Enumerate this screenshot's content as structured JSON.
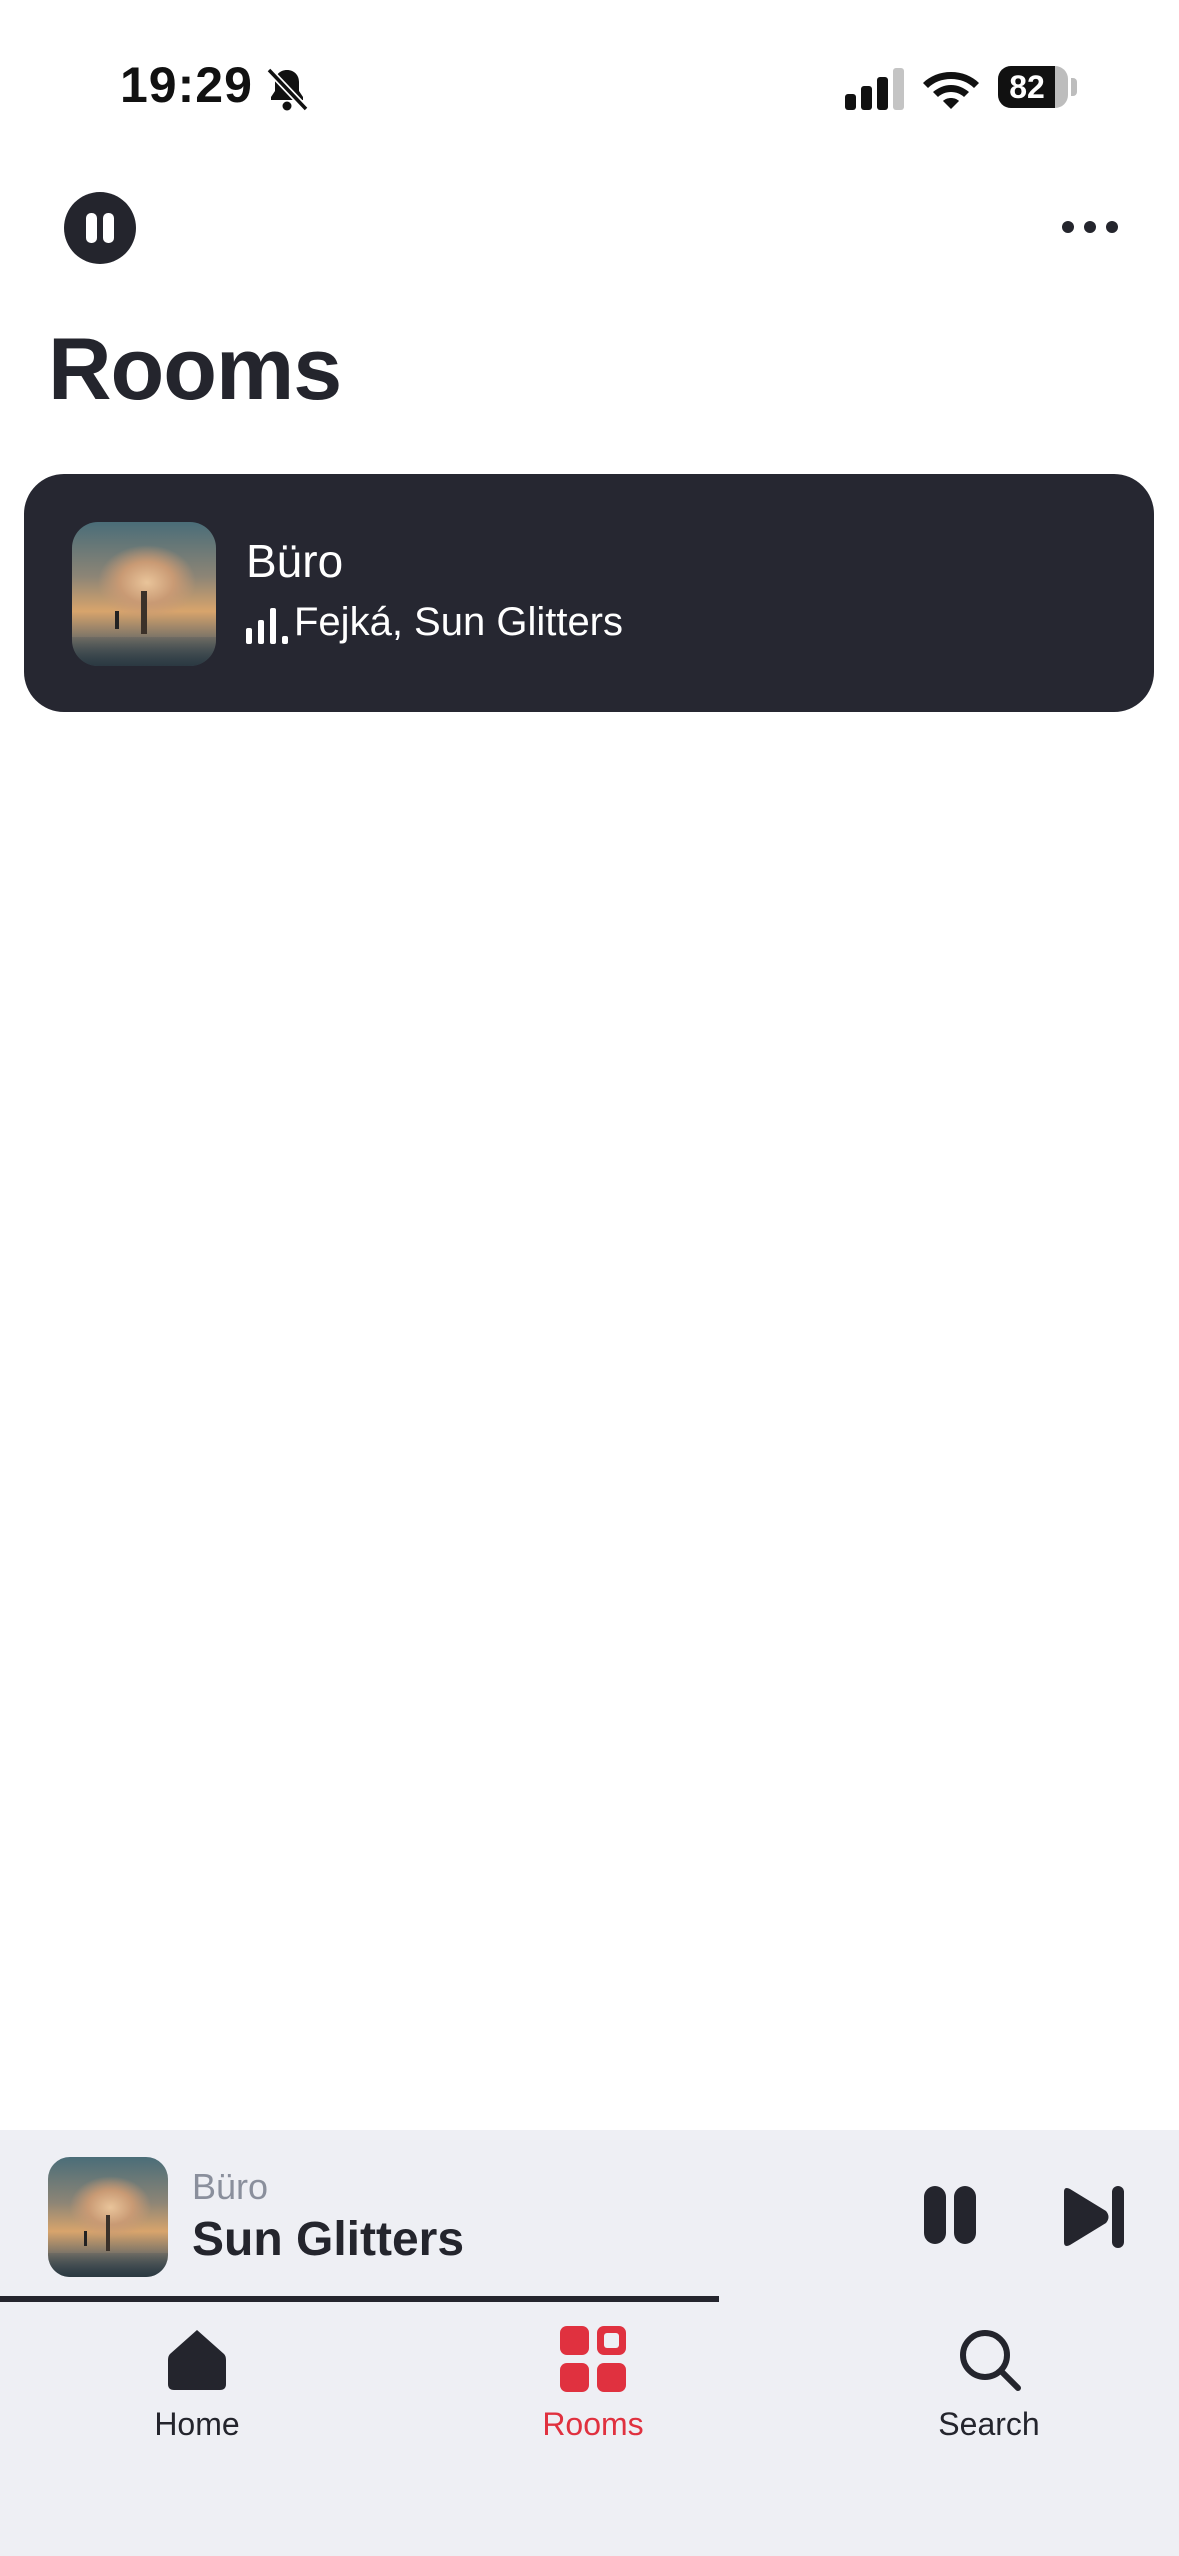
{
  "status_bar": {
    "time": "19:29",
    "battery": "82",
    "icons": [
      "bell-slash-icon",
      "cellular-signal-icon",
      "wifi-icon",
      "battery-icon"
    ]
  },
  "header": {
    "play_state_icon": "pause-icon",
    "more_icon": "ellipsis-icon",
    "title": "Rooms"
  },
  "rooms": [
    {
      "name": "Büro",
      "now_playing": "Fejká, Sun Glitters",
      "playing_icon": "equalizer-icon"
    }
  ],
  "mini_player": {
    "room": "Büro",
    "title": "Sun Glitters",
    "progress": 0.61,
    "controls": [
      "pause-icon",
      "skip-next-icon"
    ]
  },
  "tabs": [
    {
      "label": "Home",
      "icon": "home-icon",
      "active": false
    },
    {
      "label": "Rooms",
      "icon": "rooms-grid-icon",
      "active": true
    },
    {
      "label": "Search",
      "icon": "search-icon",
      "active": false
    }
  ],
  "colors": {
    "accent": "#e0313f",
    "dark": "#24252d",
    "card": "#262731",
    "bar_bg": "#eeeff4"
  }
}
